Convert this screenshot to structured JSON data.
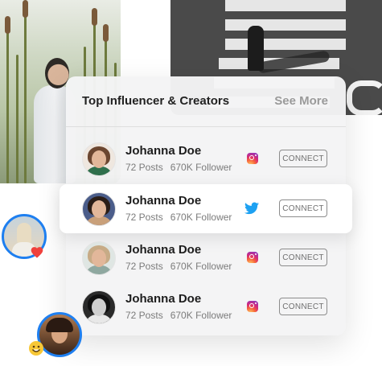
{
  "panel": {
    "title": "Top Influencer & Creators",
    "see_more": "See More"
  },
  "influencers": [
    {
      "name": "Johanna Doe",
      "posts": "72 Posts",
      "followers": "670K Follower",
      "platform": "instagram-icon",
      "action": "CONNECT"
    },
    {
      "name": "Johanna Doe",
      "posts": "72 Posts",
      "followers": "670K Follower",
      "platform": "twitter-icon",
      "action": "CONNECT"
    },
    {
      "name": "Johanna Doe",
      "posts": "72 Posts",
      "followers": "670K Follower",
      "platform": "instagram-icon",
      "action": "CONNECT"
    },
    {
      "name": "Johanna Doe",
      "posts": "72 Posts",
      "followers": "670K Follower",
      "platform": "instagram-icon",
      "action": "CONNECT"
    }
  ],
  "floating": {
    "badge_1": "heart-icon",
    "badge_2": "smile-emoji-icon"
  },
  "colors": {
    "accent_blue": "#1e7ff0",
    "twitter_blue": "#1da1f2",
    "heart_red": "#f0413c"
  }
}
